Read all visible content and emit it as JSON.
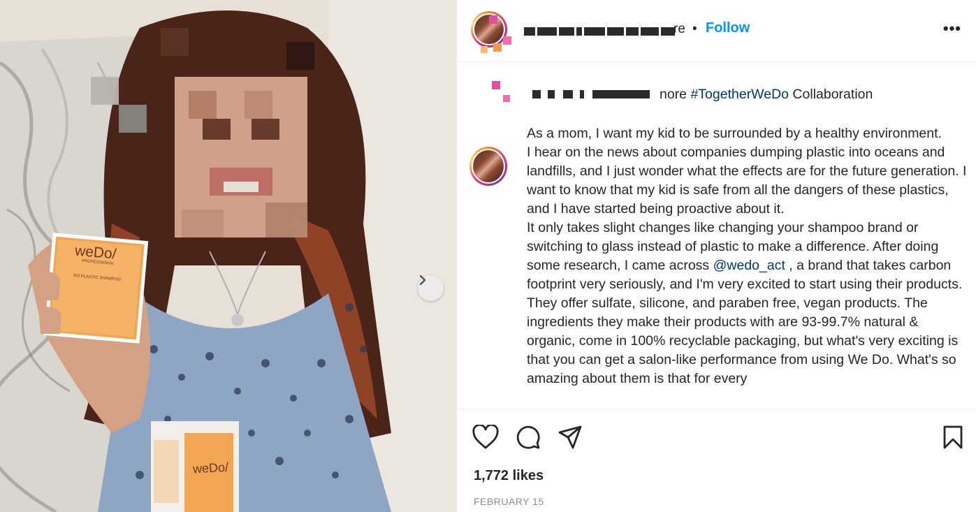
{
  "post": {
    "author_suffix": "re",
    "separator": "•",
    "follow_label": "Follow",
    "more_label": "•••",
    "caption": {
      "truncated_prefix": "nore",
      "hashtag": "#TogetherWeDo",
      "hashtag_suffix": " Collaboration",
      "body_before_mention": "As a mom, I want my kid to be surrounded by a healthy environment.\nI hear on the news about companies dumping plastic into oceans and landfills, and I just wonder what the effects are for the future generation. I want to know that my kid is safe from all the dangers of these plastics, and I have started being proactive about it.\nIt only takes slight changes like changing your shampoo brand or switching to glass instead of plastic to make a difference. After doing some research, I came across ",
      "mention": "@wedo_act",
      "body_after_mention": " , a brand that takes carbon footprint very seriously, and I'm very excited to start using their products. They offer sulfate, silicone, and paraben free, vegan products. The ingredients they make their products with are 93-99.7% natural & organic, come in 100% recyclable packaging, but what's very exciting is that you can get a salon-like performance from using We Do. What's so amazing about them is that for every"
    },
    "likes": "1,772 likes",
    "date": "FEBRUARY 15"
  },
  "media": {
    "product_brand": "weDo/",
    "product_subtitle": "PROFESSIONAL",
    "product_line": "NO PLASTIC SHAMPOO"
  },
  "icons": {
    "like": "heart-icon",
    "comment": "comment-icon",
    "share": "send-icon",
    "save": "bookmark-icon",
    "next": "chevron-right-icon"
  },
  "colors": {
    "follow": "#0095f6",
    "link": "#00376b",
    "muted": "#8e8e8e",
    "product_orange": "#f5a04a"
  }
}
